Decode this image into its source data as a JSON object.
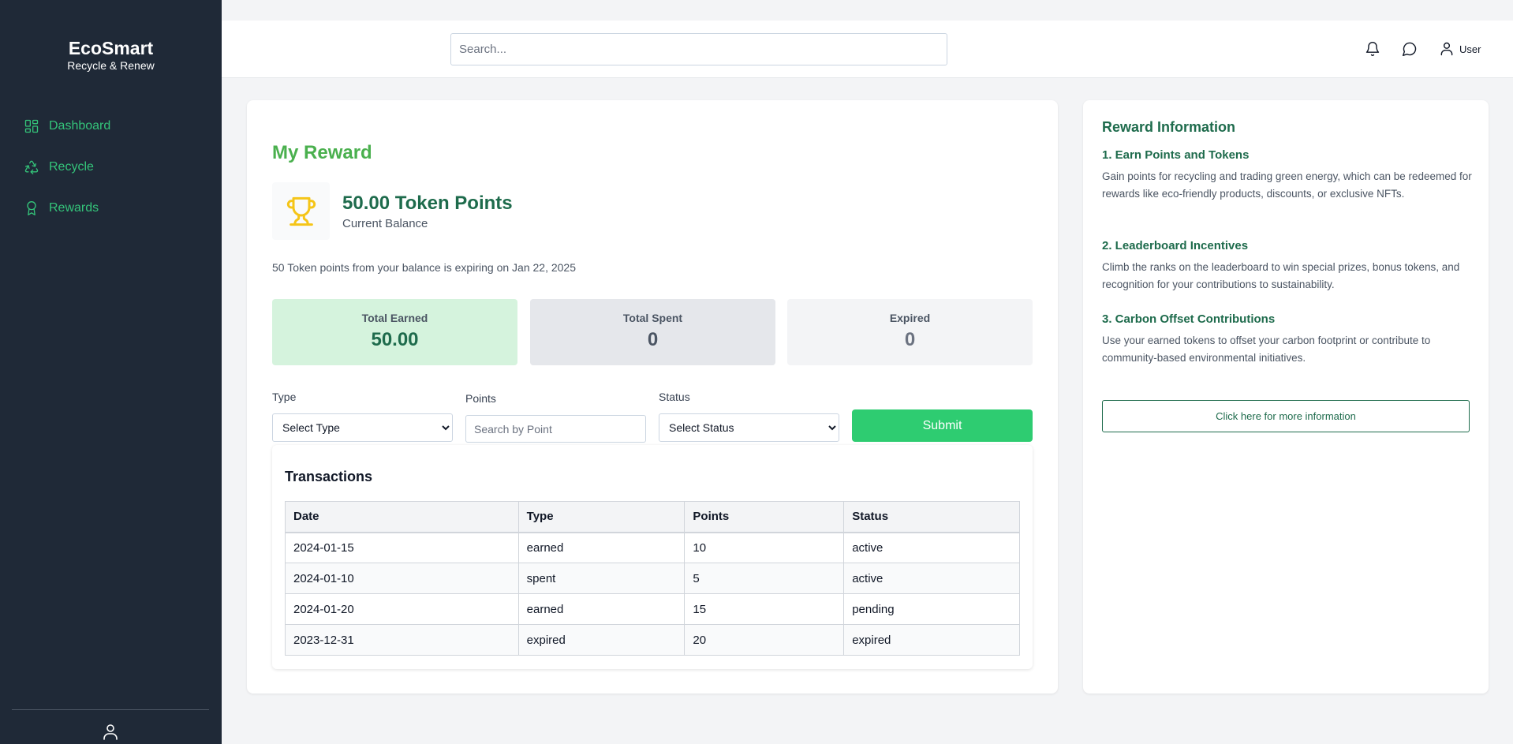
{
  "sidebar": {
    "brand": {
      "title": "EcoSmart",
      "subtitle": "Recycle & Renew"
    },
    "items": [
      {
        "label": "Dashboard",
        "icon": "dashboard-icon"
      },
      {
        "label": "Recycle",
        "icon": "recycle-icon"
      },
      {
        "label": "Rewards",
        "icon": "award-icon"
      }
    ],
    "accent_color": "#34c47a",
    "background_color": "#1f2937"
  },
  "topbar": {
    "search_placeholder": "Search...",
    "user_label": "User",
    "icons": [
      "bell-icon",
      "chat-icon",
      "user-icon"
    ]
  },
  "reward": {
    "title": "My Reward",
    "balance_value": "50.00 Token Points",
    "balance_label": "Current Balance",
    "expiry_note": "50 Token points from your balance is expiring on Jan 22, 2025",
    "stats": [
      {
        "label": "Total Earned",
        "value": "50.00"
      },
      {
        "label": "Total Spent",
        "value": "0"
      },
      {
        "label": "Expired",
        "value": "0"
      }
    ]
  },
  "filters": {
    "type_label": "Type",
    "type_selected": "Select Type",
    "points_label": "Points",
    "points_placeholder": "Search by Point",
    "status_label": "Status",
    "status_selected": "Select Status",
    "submit_label": "Submit"
  },
  "transactions": {
    "title": "Transactions",
    "columns": [
      "Date",
      "Type",
      "Points",
      "Status"
    ],
    "rows": [
      [
        "2024-01-15",
        "earned",
        "10",
        "active"
      ],
      [
        "2024-01-10",
        "spent",
        "5",
        "active"
      ],
      [
        "2024-01-20",
        "earned",
        "15",
        "pending"
      ],
      [
        "2023-12-31",
        "expired",
        "20",
        "expired"
      ]
    ]
  },
  "info": {
    "title": "Reward Information",
    "sections": [
      {
        "heading": "1. Earn Points and Tokens",
        "text": "Gain points for recycling and trading green energy, which can be redeemed for rewards like eco-friendly products, discounts, or exclusive NFTs."
      },
      {
        "heading": "2. Leaderboard Incentives",
        "text": "Climb the ranks on the leaderboard to win special prizes, bonus tokens, and recognition for your contributions to sustainability."
      },
      {
        "heading": "3. Carbon Offset Contributions",
        "text": "Use your earned tokens to offset your carbon footprint or contribute to community-based environmental initiatives."
      }
    ],
    "button_label": "Click here for more information"
  }
}
